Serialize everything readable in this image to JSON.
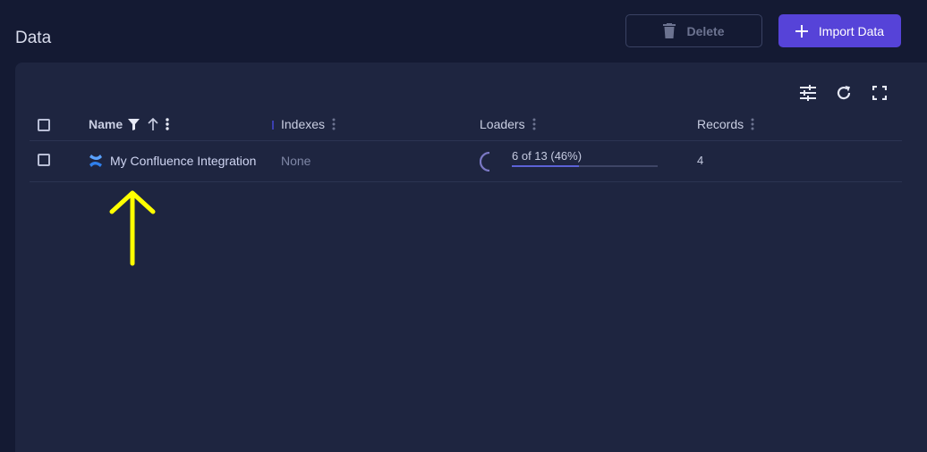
{
  "page": {
    "title": "Data"
  },
  "actions": {
    "delete_label": "Delete",
    "import_label": "Import Data"
  },
  "toolbar": {
    "icons": [
      "tune-icon",
      "refresh-icon",
      "fullscreen-icon"
    ]
  },
  "table": {
    "columns": {
      "name": "Name",
      "indexes": "Indexes",
      "loaders": "Loaders",
      "records": "Records"
    },
    "rows": [
      {
        "name": "My Confluence Integration",
        "icon": "confluence-icon",
        "indexes": "None",
        "loaders_text": "6 of 13 (46%)",
        "loaders_progress": 0.46,
        "records": "4"
      }
    ]
  },
  "colors": {
    "accent": "#5643d8",
    "background": "#141a33",
    "panel": "#1e2540",
    "annotation": "#ffff00"
  }
}
